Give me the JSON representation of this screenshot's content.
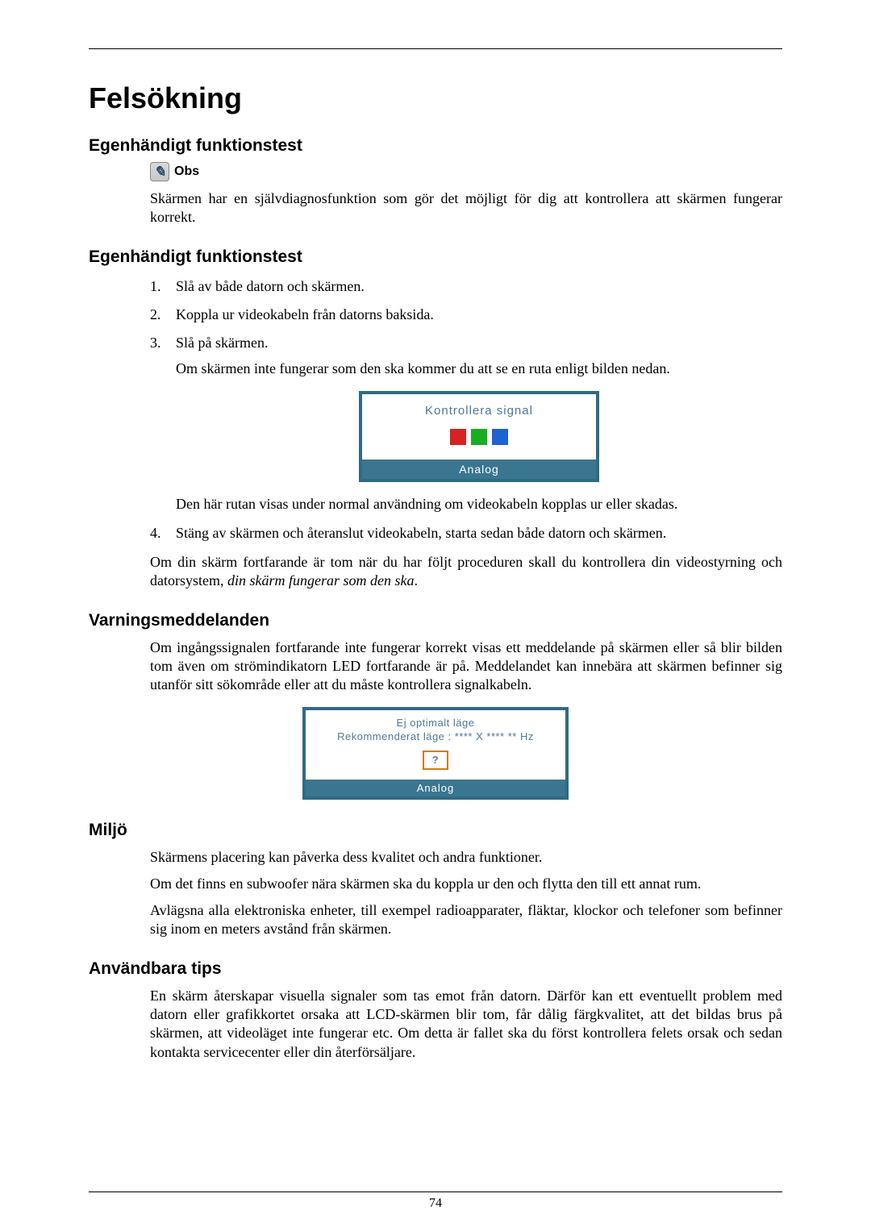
{
  "pageNumber": "74",
  "title": "Felsökning",
  "sec1_heading": "Egenhändigt funktionstest",
  "obs_label": "Obs",
  "sec1_para": "Skärmen har en självdiagnosfunktion som gör det möjligt för dig att kontrollera att skärmen fungerar korrekt.",
  "sec2_heading": "Egenhändigt funktionstest",
  "steps": {
    "s1": "Slå av både datorn och skärmen.",
    "s2": "Koppla ur videokabeln från datorns baksida.",
    "s3": "Slå på skärmen.",
    "s3_note": "Om skärmen inte fungerar som den ska kommer du att se en ruta enligt bilden nedan.",
    "s3_after": "Den här rutan visas under normal användning om videokabeln kopplas ur eller skadas.",
    "s4": "Stäng av skärmen och återanslut videokabeln, starta sedan både datorn och skärmen."
  },
  "sec2_followup_prefix": "Om din skärm fortfarande är tom när du har följt proceduren skall du kontrollera din videostyrning och datorsystem, ",
  "sec2_followup_em": "din skärm fungerar som den ska",
  "sec2_followup_suffix": ".",
  "diag1": {
    "title": "Kontrollera signal",
    "footer": "Analog"
  },
  "sec3_heading": "Varningsmeddelanden",
  "sec3_para": "Om ingångssignalen fortfarande inte fungerar korrekt visas ett meddelande på skärmen eller så blir bilden tom även om strömindikatorn LED fortfarande är på. Meddelandet kan innebära att skärmen befinner sig utanför sitt sökområde eller att du måste kontrollera signalkabeln.",
  "diag2": {
    "line1": "Ej optimalt läge",
    "line2": "Rekommenderat läge :  **** X **** ** Hz",
    "q": "?",
    "footer": "Analog"
  },
  "sec4_heading": "Miljö",
  "sec4_p1": "Skärmens placering kan påverka dess kvalitet och andra funktioner.",
  "sec4_p2": "Om det finns en subwoofer nära skärmen ska du koppla ur den och flytta den till ett annat rum.",
  "sec4_p3": "Avlägsna alla elektroniska enheter, till exempel radioapparater, fläktar, klockor och telefoner som befinner sig inom en meters avstånd från skärmen.",
  "sec5_heading": "Användbara tips",
  "sec5_para": "En skärm återskapar visuella signaler som tas emot från datorn. Därför kan ett eventuellt problem med datorn eller grafikkortet orsaka att LCD-skärmen blir tom, får dålig färgkvalitet, att det bildas brus på skärmen, att videoläget inte fungerar etc. Om detta är fallet ska du först kontrollera felets orsak och sedan kontakta servicecenter eller din återförsäljare."
}
